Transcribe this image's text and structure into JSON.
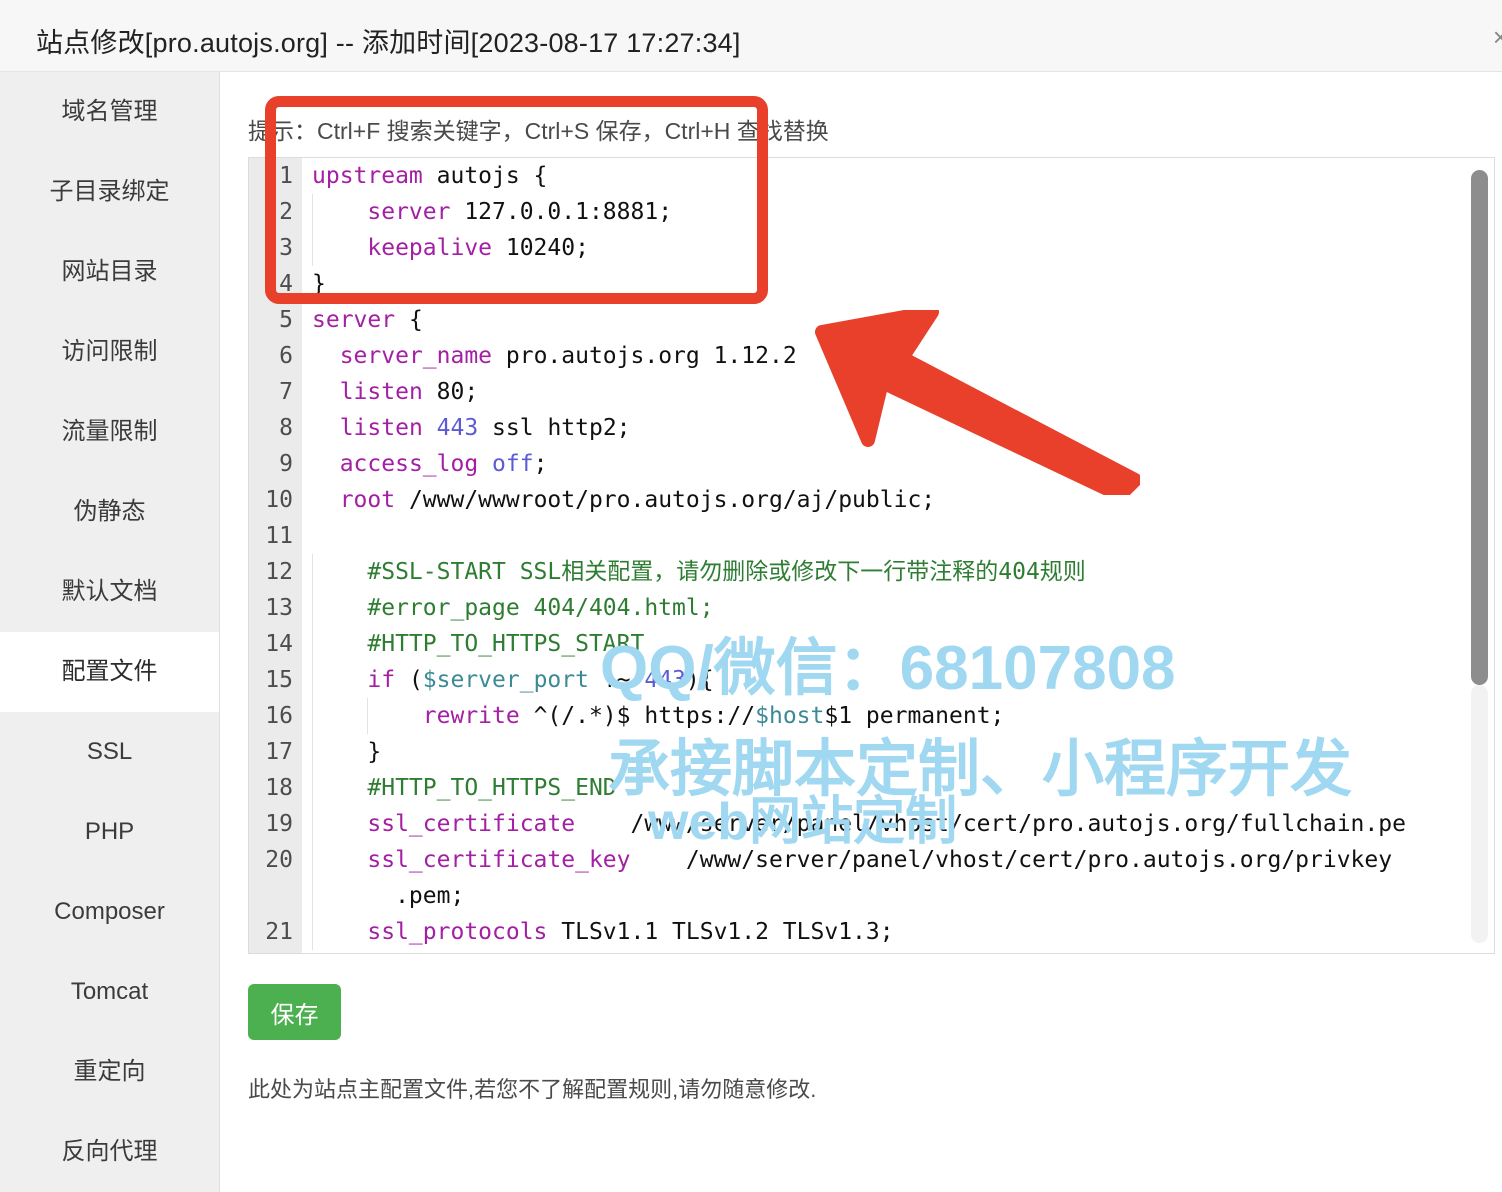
{
  "header": {
    "title": "站点修改[pro.autojs.org] -- 添加时间[2023-08-17 17:27:34]",
    "close_label": "×"
  },
  "sidebar": {
    "items": [
      {
        "label": "域名管理",
        "active": false
      },
      {
        "label": "子目录绑定",
        "active": false
      },
      {
        "label": "网站目录",
        "active": false
      },
      {
        "label": "访问限制",
        "active": false
      },
      {
        "label": "流量限制",
        "active": false
      },
      {
        "label": "伪静态",
        "active": false
      },
      {
        "label": "默认文档",
        "active": false
      },
      {
        "label": "配置文件",
        "active": true
      },
      {
        "label": "SSL",
        "active": false
      },
      {
        "label": "PHP",
        "active": false
      },
      {
        "label": "Composer",
        "active": false
      },
      {
        "label": "Tomcat",
        "active": false
      },
      {
        "label": "重定向",
        "active": false
      },
      {
        "label": "反向代理",
        "active": false
      }
    ]
  },
  "main": {
    "hint": "提示：Ctrl+F 搜索关键字，Ctrl+S 保存，Ctrl+H 查找替换",
    "save_label": "保存",
    "footnote": "此处为站点主配置文件,若您不了解配置规则,请勿随意修改."
  },
  "editor": {
    "line_numbers": [
      "1",
      "2",
      "3",
      "4",
      "5",
      "6",
      "7",
      "8",
      "9",
      "10",
      "11",
      "12",
      "13",
      "14",
      "15",
      "16",
      "17",
      "18",
      "19",
      "20",
      "",
      "21"
    ],
    "lines": [
      {
        "n": "1",
        "text": "upstream autojs {"
      },
      {
        "n": "2",
        "text": "    server 127.0.0.1:8881;"
      },
      {
        "n": "3",
        "text": "    keepalive 10240;"
      },
      {
        "n": "4",
        "text": "}"
      },
      {
        "n": "5",
        "text": "server {"
      },
      {
        "n": "6",
        "text": "  server_name pro.autojs.org 1.12.2"
      },
      {
        "n": "7",
        "text": "  listen 80;"
      },
      {
        "n": "8",
        "text": "  listen 443 ssl http2;"
      },
      {
        "n": "9",
        "text": "  access_log off;"
      },
      {
        "n": "10",
        "text": "  root /www/wwwroot/pro.autojs.org/aj/public;"
      },
      {
        "n": "11",
        "text": ""
      },
      {
        "n": "12",
        "text": "    #SSL-START SSL相关配置，请勿删除或修改下一行带注释的404规则"
      },
      {
        "n": "13",
        "text": "    #error_page 404/404.html;"
      },
      {
        "n": "14",
        "text": "    #HTTP_TO_HTTPS_START"
      },
      {
        "n": "15",
        "text": "    if ($server_port !~ 443){"
      },
      {
        "n": "16",
        "text": "        rewrite ^(/.*)$ https://$host$1 permanent;"
      },
      {
        "n": "17",
        "text": "    }"
      },
      {
        "n": "18",
        "text": "    #HTTP_TO_HTTPS_END"
      },
      {
        "n": "19",
        "text": "    ssl_certificate    /www/server/panel/vhost/cert/pro.autojs.org/fullchain.pe"
      },
      {
        "n": "20",
        "text": "    ssl_certificate_key    /www/server/panel/vhost/cert/pro.autojs.org/privkey"
      },
      {
        "n": "",
        "text": "      .pem;"
      },
      {
        "n": "21",
        "text": "    ssl_protocols TLSv1.1 TLSv1.2 TLSv1.3;"
      }
    ]
  },
  "annotations": {
    "highlight_color": "#e8402a",
    "highlight_target": "upstream autojs block (lines 1-4)",
    "arrow_color": "#e8402a"
  },
  "watermark": {
    "color": "#9fd8f0",
    "line1": "QQ/微信：68107808",
    "line2": "承接脚本定制、小程序开发",
    "line3": "web网站定制"
  }
}
